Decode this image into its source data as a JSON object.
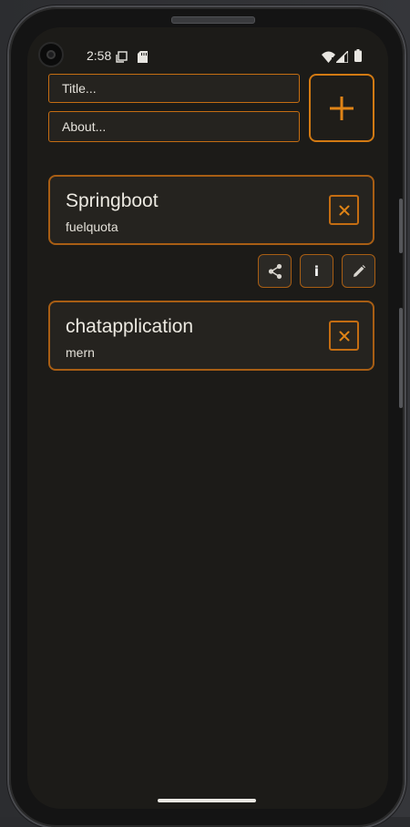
{
  "status_bar": {
    "time": "2:58",
    "icons": [
      "screenshot-icon",
      "sd-card-icon",
      "wifi-icon",
      "signal-icon",
      "battery-icon"
    ]
  },
  "form": {
    "title_placeholder": "Title...",
    "title_value": "",
    "about_placeholder": "About...",
    "about_value": "",
    "add_button_icon": "plus-icon"
  },
  "notes": [
    {
      "title": "Springboot",
      "about": "fuelquota"
    },
    {
      "title": "chatapplication",
      "about": "mern"
    }
  ],
  "actions": {
    "share_icon": "share-icon",
    "info_label": "i",
    "edit_icon": "pencil-icon"
  },
  "colors": {
    "accent": "#d27a13",
    "background": "#1c1b18",
    "card_border": "#a85e14",
    "text": "#ece9e1"
  }
}
